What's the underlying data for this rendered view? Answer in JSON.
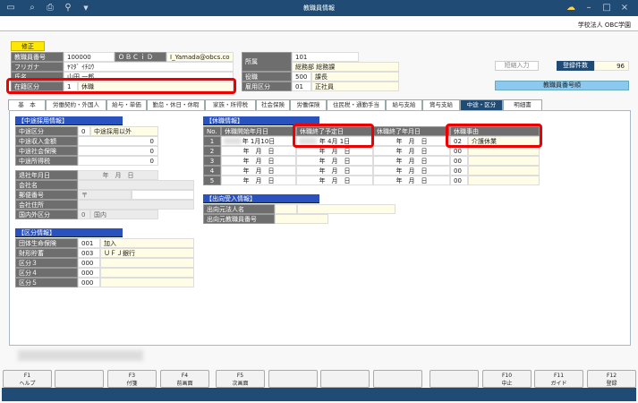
{
  "window": {
    "title": "教職員情報",
    "org": "学校法人 OBC学園"
  },
  "header": {
    "mode_badge": "修正",
    "employee_no": {
      "label": "教職員番号",
      "value": "100000"
    },
    "obcid": {
      "label": "ＯＢＣｉＤ",
      "value": "I_Yamada@obcs.co"
    },
    "furigana": {
      "label": "フリガナ",
      "value": "ﾔﾏﾀﾞ ｲﾁﾛｳ"
    },
    "name": {
      "label": "氏名",
      "value": "山田 一郎"
    },
    "status": {
      "label": "在籍区分",
      "code": "1",
      "value": "休職"
    },
    "dept": {
      "label": "所属",
      "code": "101",
      "value": "総務部 総務課"
    },
    "position": {
      "label": "役職",
      "code": "500",
      "value": "課長"
    },
    "employment": {
      "label": "雇用区分",
      "code": "01",
      "value": "正社員"
    },
    "shortcut_button": "短縮入力",
    "count_label": "登録件数",
    "count_value": "96",
    "sort_order": "教職員番号順"
  },
  "tabs": [
    "基　本",
    "労働契約・外国人",
    "給与・単価",
    "勤怠・休日・休暇",
    "家族・所得税",
    "社会保険",
    "労働保険",
    "住民税・通勤手当",
    "給与支給",
    "賞与支給",
    "中途・区分",
    "明細書"
  ],
  "midcareer": {
    "title": "【中途採用情報】",
    "rows": [
      {
        "label": "中途区分",
        "code": "0",
        "value": "中途採用以外"
      },
      {
        "label": "中途収入金額",
        "value": "0"
      },
      {
        "label": "中途社会保険",
        "value": "0"
      },
      {
        "label": "中途所得税",
        "value": "0"
      }
    ],
    "retire_date": {
      "label": "退社年月日",
      "value": "年　月　日"
    },
    "company": {
      "label": "会社名"
    },
    "postal": {
      "label": "郵便番号",
      "value": "〒"
    },
    "address": {
      "label": "会社住所"
    },
    "domestic": {
      "label": "国内外区分",
      "code": "0",
      "value": "国内"
    }
  },
  "category": {
    "title": "【区分情報】",
    "rows": [
      {
        "label": "団体生命保険",
        "code": "001",
        "value": "加入"
      },
      {
        "label": "財形貯蓄",
        "code": "003",
        "value": "ＵＦＪ銀行"
      },
      {
        "label": "区分３",
        "code": "000",
        "value": ""
      },
      {
        "label": "区分４",
        "code": "000",
        "value": ""
      },
      {
        "label": "区分５",
        "code": "000",
        "value": ""
      }
    ]
  },
  "leave": {
    "title": "【休職情報】",
    "headers": [
      "No.",
      "休職開始年月日",
      "休職終了予定日",
      "休職終了年月日",
      "休職事由"
    ],
    "rows": [
      {
        "no": "1",
        "start": "年 1月10日",
        "planned": "年 4月 1日",
        "end": "年　月　日",
        "code": "02",
        "reason": "介護休業"
      },
      {
        "no": "2",
        "start": "年　月　日",
        "planned": "年　月　日",
        "end": "年　月　日",
        "code": "00",
        "reason": ""
      },
      {
        "no": "3",
        "start": "年　月　日",
        "planned": "年　月　日",
        "end": "年　月　日",
        "code": "00",
        "reason": ""
      },
      {
        "no": "4",
        "start": "年　月　日",
        "planned": "年　月　日",
        "end": "年　月　日",
        "code": "00",
        "reason": ""
      },
      {
        "no": "5",
        "start": "年　月　日",
        "planned": "年　月　日",
        "end": "年　月　日",
        "code": "00",
        "reason": ""
      }
    ]
  },
  "secondment": {
    "title": "【出向受入情報】",
    "rows": [
      {
        "label": "出向元法人名"
      },
      {
        "label": "出向元教職員番号"
      }
    ]
  },
  "fkeys": [
    {
      "key": "F1",
      "label": "ヘルプ"
    },
    {
      "key": "",
      "label": ""
    },
    {
      "key": "F3",
      "label": "付箋"
    },
    {
      "key": "F4",
      "label": "前画面"
    },
    {
      "key": "F5",
      "label": "次画面"
    },
    {
      "key": "",
      "label": ""
    },
    {
      "key": "",
      "label": ""
    },
    {
      "key": "",
      "label": ""
    },
    {
      "key": "",
      "label": ""
    },
    {
      "key": "F10",
      "label": "中止"
    },
    {
      "key": "F11",
      "label": "ガイド"
    },
    {
      "key": "F12",
      "label": "登録"
    }
  ]
}
